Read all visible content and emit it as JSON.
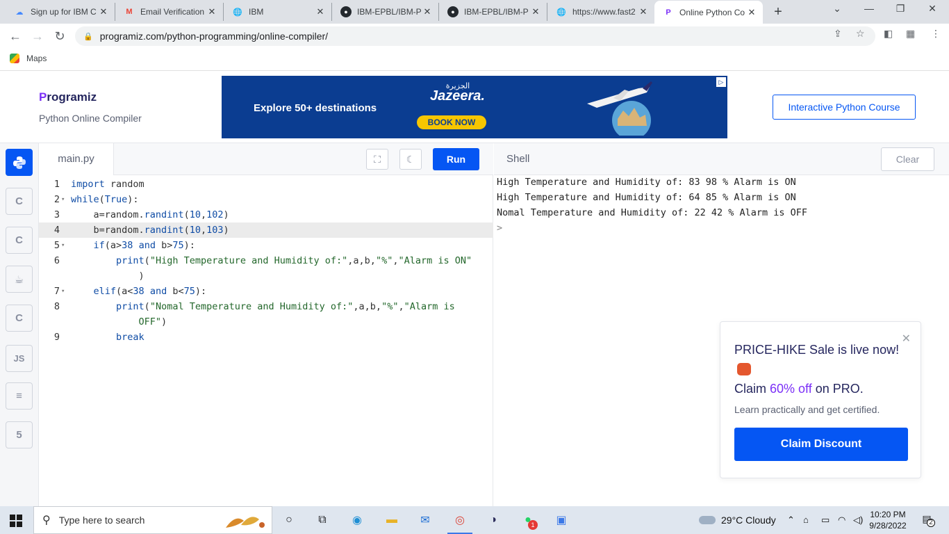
{
  "browser": {
    "tabs": [
      {
        "label": "Sign up for IBM C",
        "icon": "ibm-cloud-icon",
        "active": false
      },
      {
        "label": "Email Verification",
        "icon": "gmail-icon",
        "active": false
      },
      {
        "label": "IBM",
        "icon": "globe-icon",
        "active": false
      },
      {
        "label": "IBM-EPBL/IBM-P",
        "icon": "github-icon",
        "active": false
      },
      {
        "label": "IBM-EPBL/IBM-P",
        "icon": "github-icon",
        "active": false
      },
      {
        "label": "https://www.fast2",
        "icon": "globe-icon",
        "active": false
      },
      {
        "label": "Online Python Co",
        "icon": "programiz-icon",
        "active": true
      }
    ],
    "url": "programiz.com/python-programming/online-compiler/",
    "bookmarks": [
      {
        "label": "Maps"
      }
    ]
  },
  "header": {
    "logo": "rogramiz",
    "logo_mark": "P",
    "subtitle": "Python Online Compiler",
    "course_button": "Interactive Python Course"
  },
  "ad": {
    "headline": "Explore 50+ destinations",
    "brand": "Jazeera.",
    "brand_arabic": "الجزيرة",
    "cta": "BOOK NOW"
  },
  "languages": [
    {
      "name": "python",
      "label": "Py",
      "active": true
    },
    {
      "name": "c",
      "label": "C"
    },
    {
      "name": "cpp",
      "label": "C"
    },
    {
      "name": "java",
      "label": "☕"
    },
    {
      "name": "csharp",
      "label": "C"
    },
    {
      "name": "js",
      "label": "JS"
    },
    {
      "name": "sql",
      "label": "≡"
    },
    {
      "name": "html",
      "label": "5"
    }
  ],
  "editor": {
    "filename": "main.py",
    "run_label": "Run",
    "lines": [
      {
        "n": "1",
        "text": "import random"
      },
      {
        "n": "2",
        "text": "while(True):"
      },
      {
        "n": "3",
        "text": "    a=random.randint(10,102)"
      },
      {
        "n": "4",
        "text": "    b=random.randint(10,103)"
      },
      {
        "n": "5",
        "text": "    if(a>38 and b>75):"
      },
      {
        "n": "6",
        "text": "        print(\"High Temperature and Humidity of:\",a,b,\"%\",\"Alarm is ON\""
      },
      {
        "n": "",
        "text": "            )"
      },
      {
        "n": "7",
        "text": "    elif(a<38 and b<75):"
      },
      {
        "n": "8",
        "text": "        print(\"Nomal Temperature and Humidity of:\",a,b,\"%\",\"Alarm is"
      },
      {
        "n": "",
        "text": "            OFF\")"
      },
      {
        "n": "9",
        "text": "        break"
      }
    ]
  },
  "shell": {
    "title": "Shell",
    "clear_label": "Clear",
    "output": [
      "High Temperature and Humidity of: 83 98 % Alarm is ON",
      "High Temperature and Humidity of: 64 85 % Alarm is ON",
      "Nomal Temperature and Humidity of: 22 42 % Alarm is OFF",
      ">"
    ]
  },
  "promo": {
    "line1": "PRICE-HIKE Sale is live now!",
    "line2_a": "Claim ",
    "line2_highlight": "60% off",
    "line2_b": " on PRO.",
    "body": "Learn practically and get certified.",
    "cta": "Claim Discount"
  },
  "taskbar": {
    "search_placeholder": "Type here to search",
    "weather": "29°C  Cloudy",
    "time": "10:20 PM",
    "date": "9/28/2022",
    "notifications": "2",
    "whatsapp_badge": "1"
  },
  "colors": {
    "accent": "#0556f3",
    "brand_purple": "#7b2ff7",
    "ad_bg": "#0b3d91",
    "ad_cta": "#f7c600"
  }
}
